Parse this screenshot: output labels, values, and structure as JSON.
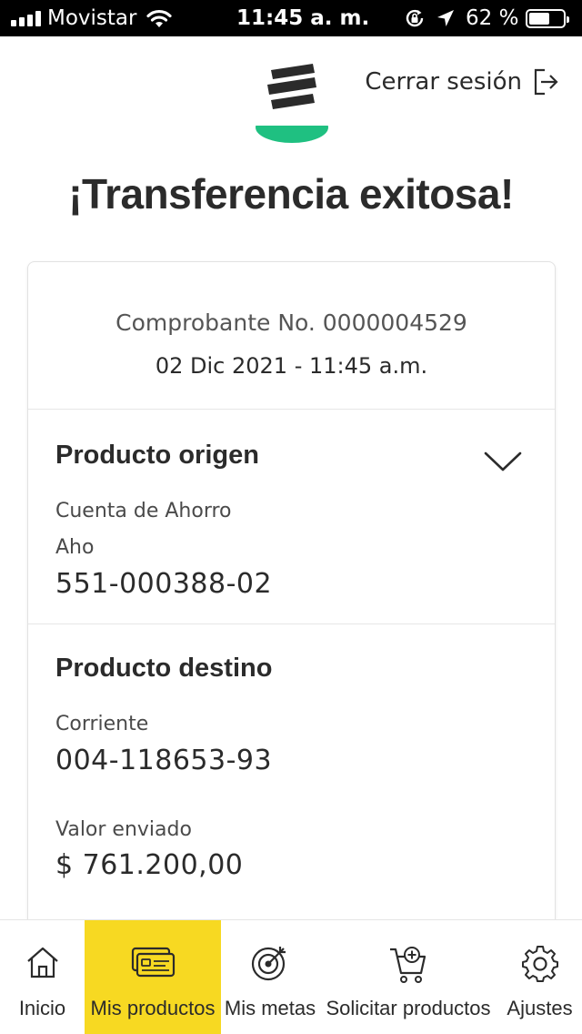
{
  "status_bar": {
    "carrier": "Movistar",
    "time": "11:45 a. m.",
    "battery_percent": "62 %",
    "battery_level": 0.62,
    "icons": [
      "signal-icon",
      "wifi-icon",
      "orientation-lock-icon",
      "location-icon",
      "battery-icon"
    ]
  },
  "header": {
    "logout_label": "Cerrar sesión",
    "logout_icon": "logout-icon",
    "logo_icon": "bank-logo-icon",
    "logo_accent_color": "#1fc081"
  },
  "title": "¡Transferencia exitosa!",
  "receipt": {
    "number_text": "Comprobante No. 0000004529",
    "datetime": "02 Dic 2021 - 11:45 a.m."
  },
  "origin": {
    "title": "Producto origen",
    "account_type": "Cuenta de Ahorro",
    "account_alias": "Aho",
    "account_number": "551-000388-02",
    "toggle_icon": "chevron-down-icon"
  },
  "destination": {
    "title": "Producto destino",
    "account_type": "Corriente",
    "account_number": "004-118653-93"
  },
  "amount": {
    "label": "Valor enviado",
    "value": "$ 761.200,00"
  },
  "nav": {
    "active_color": "#f7d922",
    "items": [
      {
        "label": "Inicio",
        "icon": "home-icon"
      },
      {
        "label": "Mis productos",
        "icon": "cards-icon"
      },
      {
        "label": "Mis metas",
        "icon": "target-icon"
      },
      {
        "label": "Solicitar productos",
        "icon": "cart-plus-icon"
      },
      {
        "label": "Ajustes",
        "icon": "gear-icon"
      }
    ]
  }
}
